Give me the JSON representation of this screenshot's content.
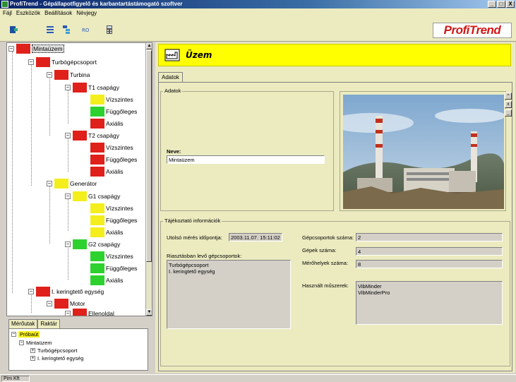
{
  "window": {
    "title": "ProfiTrend - Gépállapotfigyelő és karbantartástámogató szoftver",
    "controls": [
      "_",
      "□",
      "X"
    ]
  },
  "menu": [
    "Fájl",
    "Eszközök",
    "Beállítások",
    "Névjegy"
  ],
  "brand": "ProfiTrend",
  "tree": {
    "nodes": [
      {
        "label": "Mintaüzem"
      },
      {
        "label": "Turbógépcsoport"
      },
      {
        "label": "Turbina"
      },
      {
        "label": "T1 csapágy"
      },
      {
        "label": "Vízszintes"
      },
      {
        "label": "Függőleges"
      },
      {
        "label": "Axiális"
      },
      {
        "label": "T2 csapágy"
      },
      {
        "label": "Vízszintes"
      },
      {
        "label": "Függőleges"
      },
      {
        "label": "Axiális"
      },
      {
        "label": "Generátor"
      },
      {
        "label": "G1 csapágy"
      },
      {
        "label": "Vízszintes"
      },
      {
        "label": "Függőleges"
      },
      {
        "label": "Axiális"
      },
      {
        "label": "G2 csapágy"
      },
      {
        "label": "Vízszintes"
      },
      {
        "label": "Függőleges"
      },
      {
        "label": "Axiális"
      },
      {
        "label": "I. keringtető egység"
      },
      {
        "label": "Motor"
      },
      {
        "label": "Ellenoldal"
      }
    ]
  },
  "lower_tabs": [
    "Mérőutak",
    "Raktár"
  ],
  "lower_tree": [
    "Próbaút",
    "Mintaüzem",
    "Turbógépcsoport",
    "I. keringtető egység"
  ],
  "status": "Pim Kft",
  "detail": {
    "title": "Üzem",
    "tab": "Adatok",
    "group_adatok": "Adatok",
    "name_label": "Neve:",
    "name_value": "Mintaüzem",
    "group_info": "Tájékoztató információk",
    "last_measure_label": "Utolsó mérés időpontja:",
    "last_measure_value": "2003.11.07. 15:11:02",
    "in_stock_label": "Riasztásban levő gépcsoportok:",
    "in_stock_lines": [
      "Turbógépcsoport",
      "I. keringtető egység"
    ],
    "groups_count_label": "Gépcsoportok száma:",
    "groups_count": "2",
    "machines_count_label": "Gépek száma:",
    "machines_count": "4",
    "points_count_label": "Mérőhelyek száma:",
    "points_count": "8",
    "instruments_label": "Használt műszerek:",
    "instruments": [
      "VibMinder",
      "VibMinderPro"
    ]
  }
}
